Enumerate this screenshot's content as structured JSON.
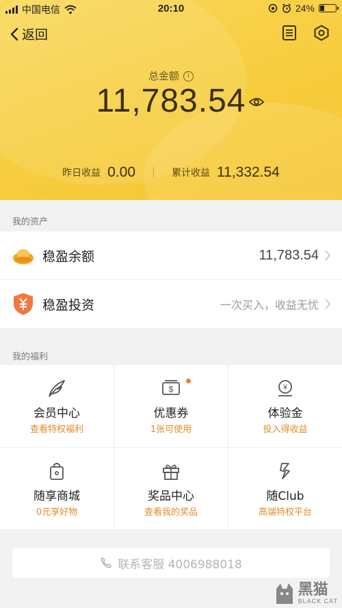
{
  "status_bar": {
    "carrier": "中国电信",
    "time": "20:10",
    "battery": "24%"
  },
  "nav": {
    "back_label": "返回"
  },
  "summary": {
    "total_label": "总金额",
    "total_amount": "11,783.54",
    "yesterday_label": "昨日收益",
    "yesterday_value": "0.00",
    "cumulative_label": "累计收益",
    "cumulative_value": "11,332.54"
  },
  "assets": {
    "title": "我的资产",
    "items": [
      {
        "name": "稳盈余额",
        "value": "11,783.54"
      },
      {
        "name": "稳盈投资",
        "desc": "一次买入，收益无忧"
      }
    ]
  },
  "benefits": {
    "title": "我的福利",
    "items": [
      {
        "name": "会员中心",
        "sub": "查看特权福利",
        "icon": "feather-icon"
      },
      {
        "name": "优惠券",
        "sub": "1张可使用",
        "icon": "coupon-icon"
      },
      {
        "name": "体验金",
        "sub": "投入得收益",
        "icon": "trial-money-icon"
      },
      {
        "name": "随享商城",
        "sub": "0元享好物",
        "icon": "shopping-bag-icon"
      },
      {
        "name": "奖品中心",
        "sub": "查看我的奖品",
        "icon": "gift-icon"
      },
      {
        "name": "随Club",
        "sub": "高端特权平台",
        "icon": "club-logo-icon"
      }
    ]
  },
  "contact": {
    "label": "联系客服 4006988018"
  },
  "watermark": {
    "brand": "黑猫",
    "brand_en": "BLACK CAT"
  }
}
